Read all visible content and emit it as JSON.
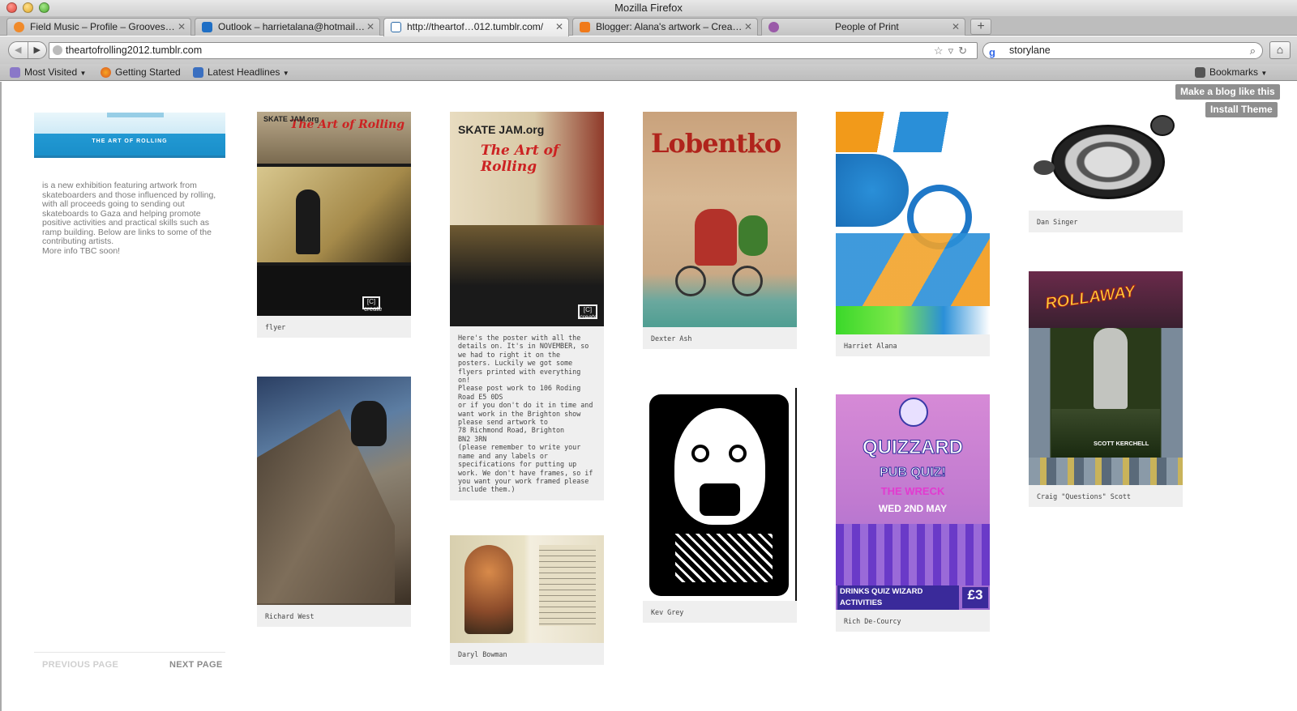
{
  "window": {
    "title": "Mozilla Firefox"
  },
  "tabs": [
    {
      "label": "Field Music – Profile – Grooves…",
      "icon_color": "#f08a2a"
    },
    {
      "label": "Outlook – harrietalana@hotmail…",
      "icon_color": "#1f6fc5"
    },
    {
      "label": "http://theartof…012.tumblr.com/",
      "icon_color": "#2b6aa8"
    },
    {
      "label": "Blogger: Alana's artwork – Crea…",
      "icon_color": "#f07a1a"
    },
    {
      "label": "People of Print",
      "icon_color": "#9a5aa8"
    }
  ],
  "nav": {
    "url": "theartofrolling2012.tumblr.com",
    "search_value": "storylane",
    "search_engine": "g"
  },
  "bookmarks": [
    {
      "label": "Most Visited"
    },
    {
      "label": "Getting Started"
    },
    {
      "label": "Latest Headlines"
    },
    {
      "label": "Bookmarks"
    }
  ],
  "theme_buttons": {
    "blog": "Make a blog like this",
    "install": "Install Theme"
  },
  "sidebar": {
    "banner_text": "THE ART OF ROLLING",
    "about": "is a new exhibition featuring artwork from skateboarders and those influenced by rolling, with all proceeds going to sending out skateboards to Gaza and helping promote positive activities and practical skills such as ramp building. Below are links to some of the contributing artists.\nMore info TBC soon!",
    "previous": "PREVIOUS PAGE",
    "next": "NEXT PAGE"
  },
  "posts": {
    "flyer": "flyer",
    "richard": "Richard West",
    "poster": "Here's the poster with all the details on. It's in NOVEMBER, so we had to right it on the posters. Luckily we got some flyers printed with everything on!\nPlease post work to 106 Roding Road E5 0DS\nor if you don't do it in time and want work in the Brighton show please send artwork to\n78 Richmond Road, Brighton\nBN2 3RN\n(please remember to write your name and any labels or specifications for putting up work. We don't have frames, so if you want your work framed please include them.)",
    "daryl": "Daryl Bowman",
    "dexter": "Dexter Ash",
    "kev": "Kev Grey",
    "harriet": "Harriet Alana",
    "rich": "Rich De-Courcy",
    "dan": "Dan Singer",
    "craig": "Craig \"Questions\" Scott"
  },
  "artwork_text": {
    "skatejam": "SKATE JAM.org",
    "art_of_rolling": "The Art of Rolling",
    "lobo": "Lobentko",
    "quiz_title": "QUIZZARD",
    "quiz_sub": "PUB QUIZ!",
    "quiz_venue": "THE WRECK",
    "quiz_date": "WED 2ND MAY",
    "quiz_footer": "DRINKS QUIZ WIZARD ACTIVITIES",
    "quiz_prize": "£3",
    "rollaway": "ROLLAWAY",
    "scott": "SCOTT KERCHELL",
    "create": "[C] create"
  },
  "colors": {
    "caption_bg": "#efefef",
    "banner_blue": "#1a8fca",
    "theme_btn": "#8f8f8f"
  }
}
